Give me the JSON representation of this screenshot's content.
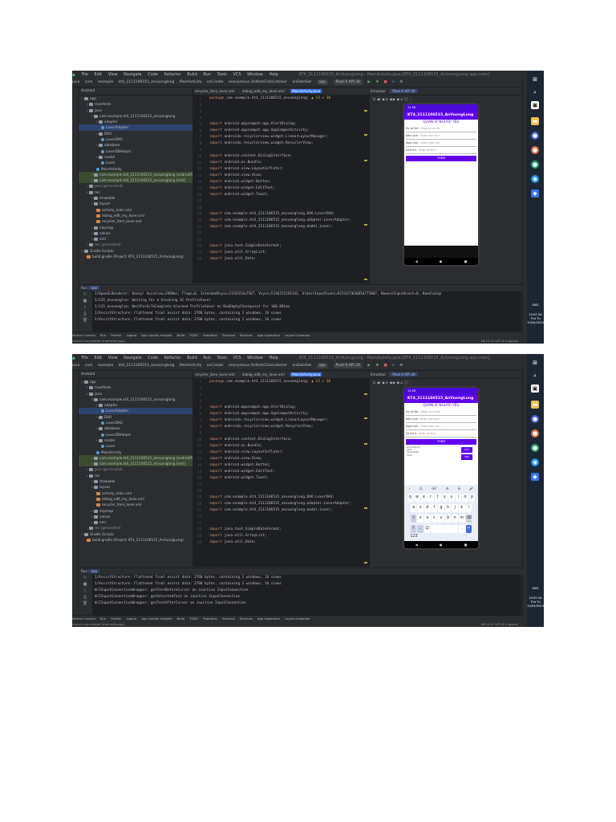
{
  "window": {
    "menu": [
      "File",
      "Edit",
      "View",
      "Navigate",
      "Code",
      "Refactor",
      "Build",
      "Run",
      "Tools",
      "VCS",
      "Window",
      "Help"
    ],
    "title": "KT4_2111106515_AnVuongLong - MainActivity.java [KT4_2111106515_AnVuongLong.app.main]",
    "window_buttons": [
      "—",
      "☐",
      "✕"
    ]
  },
  "toolbar": {
    "breadcrumbs": [
      "java",
      "com",
      "example",
      "kt4_2111106515_anvuonglong",
      "MainActivity",
      "onCreate",
      "anonymous OnItemClickListener",
      "onDateSet"
    ],
    "run_config": "app",
    "device": "Pixel 6 API 30"
  },
  "project": {
    "header": "Android",
    "tree": [
      {
        "label": "app",
        "icon": "folder",
        "depth": 0
      },
      {
        "label": "manifests",
        "icon": "folder",
        "depth": 1
      },
      {
        "label": "java",
        "icon": "folder",
        "depth": 1
      },
      {
        "label": "com.example.kt4_2111106515_anvuonglong",
        "icon": "folder",
        "depth": 2
      },
      {
        "label": "adapter",
        "icon": "folder",
        "depth": 3
      },
      {
        "label": "LoverAdapter",
        "icon": "class",
        "depth": 4,
        "state": "selected"
      },
      {
        "label": "DAO",
        "icon": "folder",
        "depth": 3
      },
      {
        "label": "LoverDAO",
        "icon": "class",
        "depth": 4
      },
      {
        "label": "database",
        "icon": "folder",
        "depth": 3
      },
      {
        "label": "LoverDBHelper",
        "icon": "class",
        "depth": 4
      },
      {
        "label": "model",
        "icon": "folder",
        "depth": 3
      },
      {
        "label": "Lover",
        "icon": "class",
        "depth": 4
      },
      {
        "label": "MainActivity",
        "icon": "class",
        "depth": 3
      },
      {
        "label": "com.example.kt4_2111106515_anvuonglong (androidTest)",
        "icon": "folder",
        "depth": 2,
        "state": "highlight"
      },
      {
        "label": "com.example.kt4_2111106515_anvuonglong (test)",
        "icon": "folder",
        "depth": 2,
        "state": "highlight"
      },
      {
        "label": "java (generated)",
        "icon": "folder",
        "depth": 1,
        "state": "generated"
      },
      {
        "label": "res",
        "icon": "folder",
        "depth": 1
      },
      {
        "label": "drawable",
        "icon": "folder",
        "depth": 2
      },
      {
        "label": "layout",
        "icon": "folder",
        "depth": 2
      },
      {
        "label": "activity_main.xml",
        "icon": "xml",
        "depth": 3
      },
      {
        "label": "dialog_edit_my_lover.xml",
        "icon": "xml",
        "depth": 3
      },
      {
        "label": "recycler_item_lover.xml",
        "icon": "xml",
        "depth": 3
      },
      {
        "label": "mipmap",
        "icon": "folder",
        "depth": 2
      },
      {
        "label": "values",
        "icon": "folder",
        "depth": 2
      },
      {
        "label": "xml",
        "icon": "folder",
        "depth": 2
      },
      {
        "label": "res (generated)",
        "icon": "folder",
        "depth": 1,
        "state": "generated"
      },
      {
        "label": "Gradle Scripts",
        "icon": "folder",
        "depth": 0
      },
      {
        "label": "build.gradle (Project: KT4_2111106515_AnVuongLong)",
        "icon": "xml",
        "depth": 1
      }
    ]
  },
  "editor": {
    "tabs": [
      "recycler_item_lover.xml",
      "dialog_edit_my_lover.xml",
      "MainActivity.java"
    ],
    "lines": [
      {
        "kw": "package",
        "text": " com.example.kt4_2111106515_anvuonglong;",
        "warn": "▲ 13  ✔ 20"
      },
      {
        "kw": "",
        "text": ""
      },
      {
        "kw": "",
        "text": ""
      },
      {
        "kw": "",
        "text": ""
      },
      {
        "kw": "import",
        "text": " android.appcompat.app.AlertDialog;"
      },
      {
        "kw": "import",
        "text": " android.appcompat.app.AppCompatActivity;"
      },
      {
        "kw": "import",
        "text": " androidx.recyclerview.widget.LinearLayoutManager;"
      },
      {
        "kw": "import",
        "text": " androidx.recyclerview.widget.RecyclerView;"
      },
      {
        "kw": "",
        "text": ""
      },
      {
        "kw": "import",
        "text": " android.content.DialogInterface;"
      },
      {
        "kw": "import",
        "text": " android.os.Bundle;"
      },
      {
        "kw": "import",
        "text": " android.view.LayoutInflater;"
      },
      {
        "kw": "import",
        "text": " android.view.View;"
      },
      {
        "kw": "import",
        "text": " android.widget.Button;"
      },
      {
        "kw": "import",
        "text": " android.widget.EditText;"
      },
      {
        "kw": "import",
        "text": " android.widget.Toast;"
      },
      {
        "kw": "",
        "text": ""
      },
      {
        "kw": "",
        "text": ""
      },
      {
        "kw": "import",
        "text": " com.example.kt4_2111106515_anvuonglong.DAO.LoverDAO;"
      },
      {
        "kw": "import",
        "text": " com.example.kt4_2111106515_anvuonglong.adapter.LoverAdapter;"
      },
      {
        "kw": "import",
        "text": " com.example.kt4_2111106515_anvuonglong.model.Lover;"
      },
      {
        "kw": "",
        "text": ""
      },
      {
        "kw": "",
        "text": ""
      },
      {
        "kw": "import",
        "text": " java.text.SimpleDateFormat;"
      },
      {
        "kw": "import",
        "text": " java.util.ArrayList;"
      },
      {
        "kw": "import",
        "text": " java.util.Date;"
      }
    ]
  },
  "preview": {
    "tabs": [
      "Emulator",
      "Pixel 6 API 30"
    ],
    "tools": "⏻ ◀) ◀  ◎  ◀  ▶  ◉  ⌂  ⬛  ⋮",
    "app": {
      "status_time": "11:56",
      "appbar_title": "KT4_2111106515_AnVuongLong",
      "heading": "QUẢN LÝ NGƯỜI YÊU",
      "fields": [
        {
          "label": "Họ và tên:",
          "placeholder": "Nhập họ và tên"
        },
        {
          "label": "Năm sinh:",
          "placeholder": "Nhập năm sinh"
        },
        {
          "label": "Ngày hẹn:",
          "placeholder": "Nhập ngày hẹn"
        },
        {
          "label": "Sở thích:",
          "placeholder": "Nhập sở thích"
        }
      ],
      "add_button": "THÊM",
      "list_items": [
        {
          "lines": [
            "anvuonglong",
            "2003",
            "01/04/2024",
            "Code"
          ],
          "button": "SỬA"
        },
        {
          "lines": [
            "",
            "",
            "",
            ""
          ],
          "button": "XÓA"
        }
      ],
      "nav": [
        "◀",
        "●",
        "■"
      ]
    },
    "keyboard": {
      "tools": [
        "‹",
        "☺",
        "GIF",
        "⚙",
        "G̶",
        "🎤"
      ],
      "row1": [
        "q",
        "w",
        "e",
        "r",
        "t",
        "y",
        "u",
        "i",
        "o",
        "p"
      ],
      "row2": [
        "a",
        "s",
        "d",
        "f",
        "g",
        "h",
        "j",
        "k",
        "l"
      ],
      "row3": [
        "⇧",
        "z",
        "x",
        "c",
        "v",
        "b",
        "n",
        "m",
        "⌫"
      ],
      "row4": [
        "?123",
        ",",
        "☺",
        "",
        ".",
        "↵"
      ]
    }
  },
  "console1": {
    "tab": "app",
    "lines": [
      "I/OpenGLRenderer: Davey! duration=2988ms; Flags=0, IntendedVsync=5333554a7567, Vsync=5336372154143, OldestInputEvent=9223372036854775807, NewestInputEvent=0, HandleInp",
      "I/135_anvuonglon: Waiting for a blocking GC ProfileSaver",
      "I/135_anvuonglon: WaitForGcToComplete blocked ProfileSaver on RunEmptyCheckpoint for 168.801ms",
      "I/AssistStructure: Flattened final assist data: 2768 bytes, containing 1 windows, 16 views",
      "I/AssistStructure: Flattened final assist data: 2768 bytes, containing 1 windows, 16 views"
    ]
  },
  "console2": {
    "tab": "app",
    "lines": [
      "I/AssistStructure: Flattened final assist data: 2768 bytes, containing 1 windows, 16 views",
      "I/AssistStructure: Flattened final assist data: 2768 bytes, containing 1 windows, 16 views",
      "W/IInputConnectionWrapper: getTextBeforeCursor on inactive InputConnection",
      "W/IInputConnectionWrapper: getSelectedText on inactive InputConnection",
      "W/IInputConnectionWrapper: getTextAfterCursor on inactive InputConnection"
    ]
  },
  "bottom_tools": [
    "Version Control",
    "Run",
    "Profiler",
    "Logcat",
    "App Quality Insights",
    "Build",
    "TODO",
    "Problems",
    "Terminal",
    "Services",
    "App Inspection",
    "Layout Inspector"
  ],
  "status": {
    "left": "Launch succeeded (moments ago)",
    "right": "28:14  LF  UTF-8  4 spaces"
  },
  "taskbar": {
    "lang": "ENG",
    "time": "10:05 SA",
    "day": "Thứ Tư",
    "date": "10/04/2024"
  },
  "colors": {
    "ide_bg": "#2b2d30",
    "editor_bg": "#1e1f22",
    "accent": "#3574f0",
    "app_primary": "#6200ee",
    "keyword": "#cf8e6d"
  }
}
